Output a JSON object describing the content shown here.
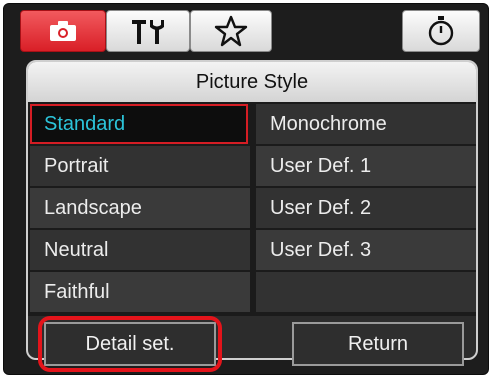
{
  "tabs": [
    {
      "icon": "camera-icon",
      "active": true
    },
    {
      "icon": "tools-icon",
      "active": false
    },
    {
      "icon": "star-icon",
      "active": false
    },
    {
      "icon": "timer-icon",
      "active": false
    }
  ],
  "panel": {
    "title": "Picture Style",
    "left_column": [
      "Standard",
      "Portrait",
      "Landscape",
      "Neutral",
      "Faithful"
    ],
    "right_column": [
      "Monochrome",
      "User Def. 1",
      "User Def. 2",
      "User Def. 3"
    ],
    "selected": "Standard"
  },
  "buttons": {
    "detail_label": "Detail set.",
    "return_label": "Return"
  },
  "colors": {
    "accent_red": "#d91f27",
    "selected_text": "#2cc4da",
    "highlight_outline": "#e4141b"
  }
}
